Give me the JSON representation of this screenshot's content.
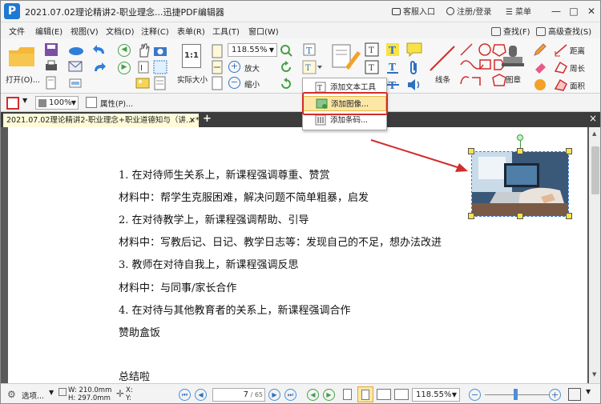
{
  "titlebar": {
    "logo": "P",
    "title": "2021.07.02理论精讲2-职业理念...迅捷PDF编辑器",
    "support": "客服入口",
    "login": "注册/登录",
    "menu": "菜单",
    "min": "—",
    "max": "□",
    "close": "✕"
  },
  "menubar": {
    "items": [
      "文件",
      "编辑(E)",
      "视图(V)",
      "文档(D)",
      "注释(C)",
      "表单(R)",
      "工具(T)",
      "窗口(W)"
    ],
    "find": "查找(F)",
    "advanced_find": "高级查找(S)"
  },
  "ribbon": {
    "open": "打开(O)...",
    "actual_size": "实际大小",
    "zoom": "118.55%",
    "zoom_in": "放大",
    "zoom_out": "缩小",
    "line": "线条",
    "stamp": "图章",
    "distance": "距离",
    "perimeter": "周长",
    "area": "面积",
    "actual_icon_text": "1:1"
  },
  "propbar": {
    "opacity": "100%",
    "properties": "属性(P)..."
  },
  "tabbar": {
    "tab_label": "2021.07.02理论精讲2-职业理念+职业道德知与（讲... *",
    "close": "×",
    "add": "+"
  },
  "dropdown": {
    "items": [
      "添加文本工具",
      "添加图像...",
      "添加条码..."
    ]
  },
  "document": {
    "lines": [
      "1. 在对待师生关系上，新课程强调尊重、赞赏",
      "材料中：帮学生克服困难，解决问题不简单粗暴，启发",
      "2. 在对待教学上，新课程强调帮助、引导",
      "材料中：写教后记、日记、教学日志等：发现自己的不足，想办法改进",
      "3. 教师在对待自我上，新课程强调反思",
      "材料中：与同事/家长合作",
      "4. 在对待与其他教育者的关系上，新课程强调合作",
      "赞助盒饭",
      "总结啦"
    ]
  },
  "statusbar": {
    "options": "选项...",
    "width": "W: 210.0mm",
    "height": "H: 297.0mm",
    "x": "X:",
    "y": "Y:",
    "page_current": "7",
    "page_total": "/ 65",
    "zoom": "118.55%"
  },
  "colors": {
    "accent_blue": "#1f78d1",
    "highlight": "#fde7a7",
    "callout_red": "#d22c2c",
    "tab_bg": "#fffbd9"
  }
}
